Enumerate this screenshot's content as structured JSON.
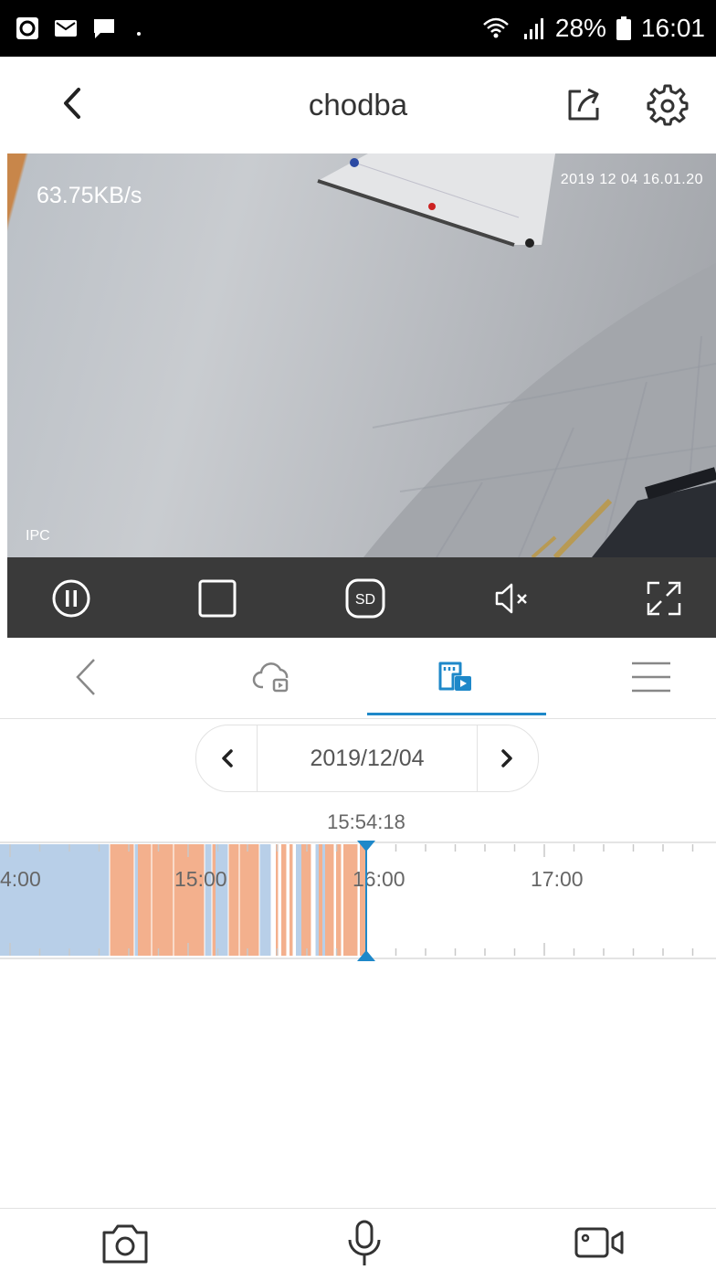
{
  "status_bar": {
    "icons_left": [
      "app-icon",
      "mail-icon",
      "message-icon",
      "dot-icon"
    ],
    "battery": "28%",
    "time": "16:01"
  },
  "header": {
    "title": "chodba"
  },
  "video": {
    "bitrate": "63.75KB/s",
    "timestamp": "2019 12 04 16.01.20",
    "watermark": "IPC"
  },
  "controls": {
    "quality_label": "SD"
  },
  "tabs": {
    "active": "sd-card-playback"
  },
  "date_selector": {
    "date": "2019/12/04"
  },
  "timeline": {
    "current_time": "15:54:18",
    "hour_labels": [
      "4:00",
      "15:00",
      "16:00",
      "17:00"
    ],
    "colors": {
      "normal": "#b8cfe8",
      "event": "#f3b08d",
      "cursor": "#1e88c9"
    }
  }
}
